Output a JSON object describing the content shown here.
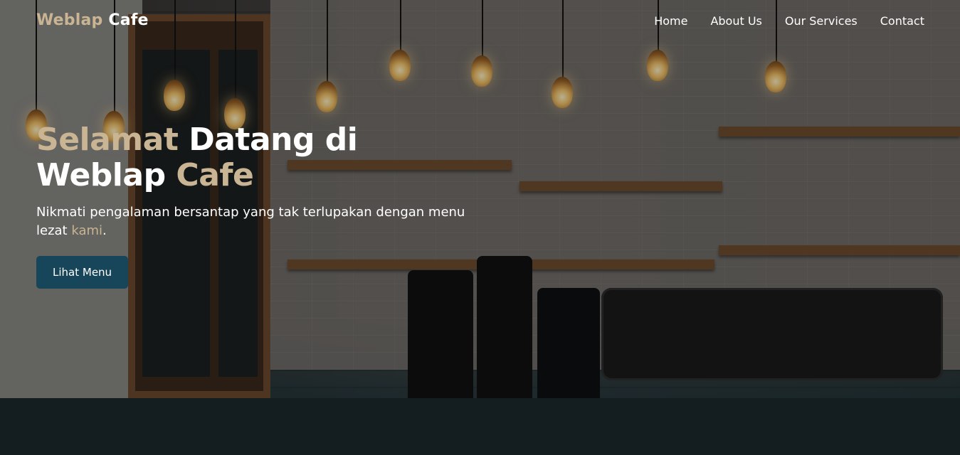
{
  "brand": {
    "part1": "Weblap",
    "part2": "Cafe"
  },
  "nav": {
    "items": [
      {
        "label": "Home"
      },
      {
        "label": "About Us"
      },
      {
        "label": "Our Services"
      },
      {
        "label": "Contact"
      }
    ]
  },
  "hero": {
    "title_word1": "Selamat",
    "title_word2": " Datang di",
    "title_word3": "Weblap",
    "title_word4": "Cafe",
    "subtitle_main": "Nikmati pengalaman bersantap yang tak terlupakan dengan menu lezat ",
    "subtitle_accent": "kami",
    "subtitle_end": ".",
    "cta_label": "Lihat Menu"
  },
  "colors": {
    "accent": "#c9b493",
    "button": "#174559",
    "text": "#ffffff"
  }
}
